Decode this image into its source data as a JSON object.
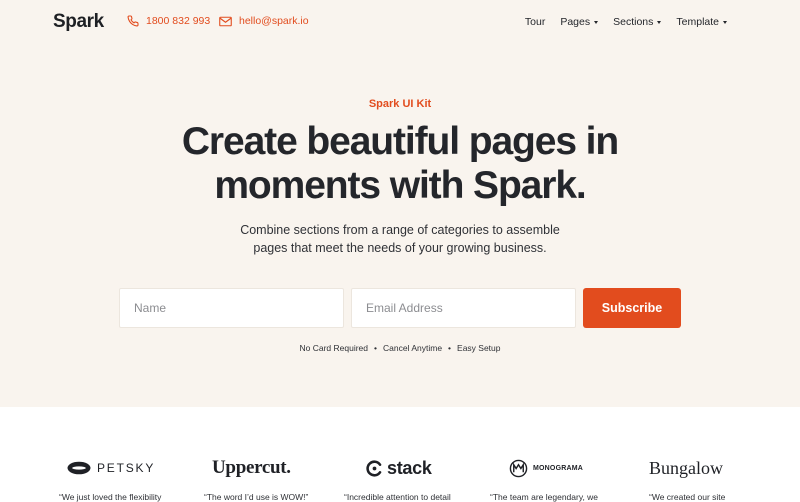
{
  "header": {
    "logo": "Spark",
    "phone": "1800 832 993",
    "email": "hello@spark.io",
    "nav": [
      {
        "label": "Tour",
        "dropdown": false
      },
      {
        "label": "Pages",
        "dropdown": true
      },
      {
        "label": "Sections",
        "dropdown": true
      },
      {
        "label": "Template",
        "dropdown": true
      }
    ]
  },
  "hero": {
    "eyebrow": "Spark UI Kit",
    "headline_line1": "Create beautiful pages in",
    "headline_line2": "moments with Spark.",
    "subtext": "Combine sections from a range of categories to assemble pages that meet the needs of your growing business.",
    "form": {
      "name_placeholder": "Name",
      "email_placeholder": "Email Address",
      "submit_label": "Subscribe"
    },
    "perks": [
      "No Card Required",
      "Cancel Anytime",
      "Easy Setup"
    ],
    "perk_separator": "•"
  },
  "logos": [
    {
      "name": "PETSKY",
      "quote": "“We just loved the flexibility"
    },
    {
      "name": "Uppercut.",
      "quote": "“The word I’d use is WOW!”"
    },
    {
      "name": "stack",
      "quote": "“Incredible attention to detail"
    },
    {
      "name": "MONOGRAMA",
      "quote": "“The team are legendary, we"
    },
    {
      "name": "Bungalow",
      "quote": "“We created our site"
    }
  ],
  "colors": {
    "accent": "#e24c1e",
    "hero_background": "#f9f4ee",
    "text": "#24262b",
    "field_border": "#ece6de"
  },
  "icons": {
    "phone": "phone-icon",
    "email": "envelope-icon",
    "dropdown": "caret-down-icon"
  }
}
